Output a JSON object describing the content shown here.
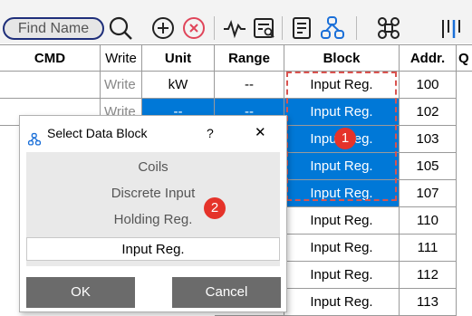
{
  "toolbar": {
    "find_label": "Find Name",
    "icons": [
      "search-icon",
      "add-circle-icon",
      "remove-circle-icon",
      "signal-icon",
      "list-search-icon",
      "document-icon",
      "hierarchy-icon",
      "command-icon",
      "columns-icon"
    ]
  },
  "table": {
    "headers": [
      "CMD",
      "Write",
      "Unit",
      "Range",
      "Block",
      "Addr.",
      "Q"
    ],
    "rows": [
      {
        "cmd": "",
        "write": "Write",
        "unit": "kW",
        "range": "--",
        "block": "Input Reg.",
        "addr": "100"
      },
      {
        "cmd": "",
        "write": "Write",
        "unit": "--",
        "range": "--",
        "block": "Input Reg.",
        "addr": "102"
      },
      {
        "cmd": "",
        "write": "",
        "unit": "",
        "range": "",
        "block": "Input Reg.",
        "addr": "103"
      },
      {
        "cmd": "",
        "write": "",
        "unit": "",
        "range": "",
        "block": "Input Reg.",
        "addr": "105"
      },
      {
        "cmd": "",
        "write": "",
        "unit": "",
        "range": "",
        "block": "Input Reg.",
        "addr": "107"
      },
      {
        "cmd": "",
        "write": "",
        "unit": "",
        "range": "",
        "block": "Input Reg.",
        "addr": "110"
      },
      {
        "cmd": "",
        "write": "",
        "unit": "",
        "range": "",
        "block": "Input Reg.",
        "addr": "111"
      },
      {
        "cmd": "",
        "write": "",
        "unit": "",
        "range": "",
        "block": "Input Reg.",
        "addr": "112"
      },
      {
        "cmd": "",
        "write": "",
        "unit": "",
        "range": "",
        "block": "Input Reg.",
        "addr": "113"
      }
    ]
  },
  "badges": {
    "one": "1",
    "two": "2"
  },
  "dialog": {
    "title": "Select Data Block",
    "help": "?",
    "close": "✕",
    "options": [
      "Coils",
      "Discrete Input",
      "Holding Reg.",
      "Input Reg."
    ],
    "selected": "Input Reg.",
    "ok_label": "OK",
    "cancel_label": "Cancel"
  },
  "colors": {
    "selection": "#0078d7",
    "badge": "#e5332a",
    "dash": "#d9534f",
    "accent": "#1a6fd8"
  }
}
